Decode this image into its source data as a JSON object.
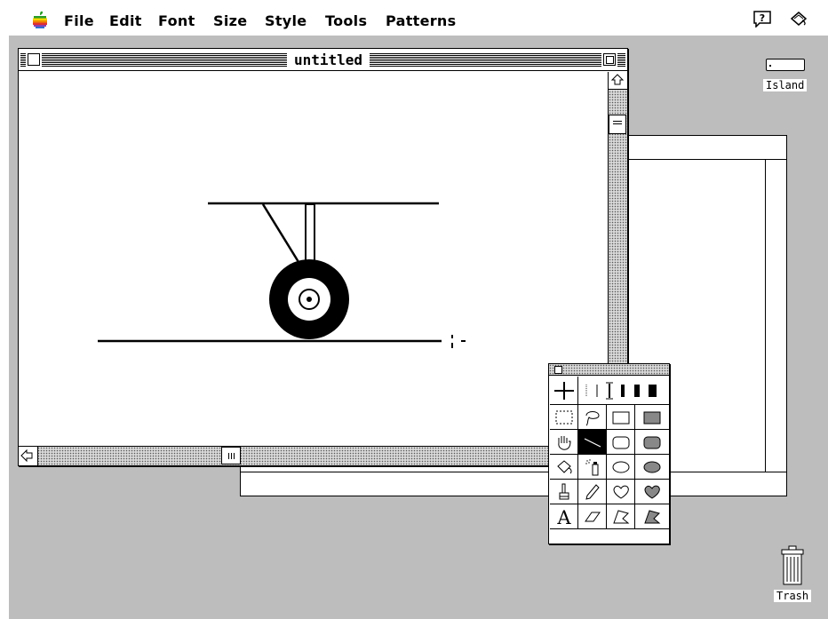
{
  "menubar": {
    "apple_icon": "apple-logo-icon",
    "items": [
      {
        "label": "File"
      },
      {
        "label": "Edit"
      },
      {
        "label": "Font"
      },
      {
        "label": "Size"
      },
      {
        "label": "Style"
      },
      {
        "label": "Tools"
      },
      {
        "label": "Patterns"
      }
    ],
    "help_icon": "question-balloon-icon",
    "app_icon": "paint-bucket-app-icon"
  },
  "document_window": {
    "title": "untitled"
  },
  "desktop": {
    "disk_label": "Island",
    "trash_label": "Trash"
  },
  "tool_palette": {
    "tools": [
      "crosshair-tool",
      "line-width-tool",
      "selection-rectangle-tool",
      "lasso-tool",
      "rectangle-tool",
      "filled-rectangle-tool",
      "hand-tool",
      "line-tool",
      "rounded-rectangle-tool",
      "filled-rounded-rectangle-tool",
      "paint-bucket-tool",
      "spray-can-tool",
      "oval-tool",
      "filled-oval-tool",
      "brush-tool",
      "pencil-tool",
      "freeform-tool",
      "filled-freeform-tool",
      "text-tool",
      "eraser-tool",
      "polygon-tool",
      "filled-polygon-tool"
    ],
    "selected_tool": "line-tool"
  },
  "colors": {
    "desktop": "#bdbdbd",
    "window": "#ffffff",
    "ink": "#000000"
  }
}
